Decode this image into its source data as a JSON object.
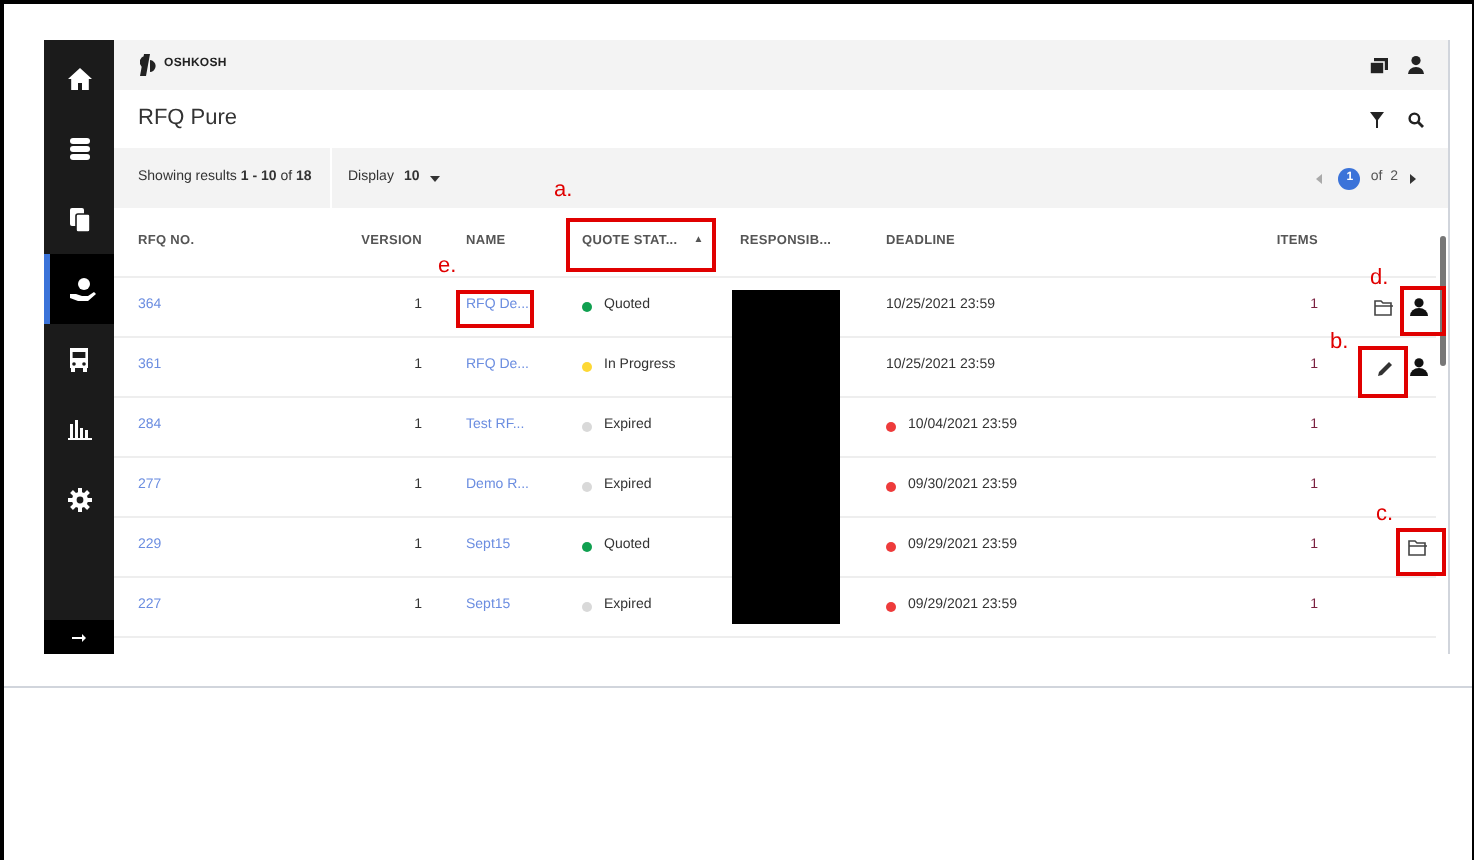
{
  "header": {
    "logo": "OSHKOSH"
  },
  "sidebar": {
    "items": [
      {
        "kind": "home",
        "selected": false
      },
      {
        "kind": "database",
        "selected": false
      },
      {
        "kind": "copies",
        "selected": false
      },
      {
        "kind": "hand",
        "selected": true
      },
      {
        "kind": "bus",
        "selected": false
      },
      {
        "kind": "chart",
        "selected": false
      },
      {
        "kind": "gear",
        "selected": false
      }
    ]
  },
  "page_title": "RFQ Pure",
  "toolbar": {
    "results": "Showing results **1 - 10** of **18**",
    "display_label": "Display",
    "display_value": "10",
    "current_page": "1",
    "of_pages": "of  2"
  },
  "table": {
    "columns": [
      {
        "label": "RFQ NO."
      },
      {
        "label": "VERSION"
      },
      {
        "label": "NAME"
      },
      {
        "label": "QUOTE STAT...",
        "sort": "▲"
      },
      {
        "label": "RESPONSIB..."
      },
      {
        "label": "DEADLINE"
      },
      {
        "label": "ITEMS"
      }
    ],
    "rows": [
      {
        "rfq": "364",
        "version": "1",
        "name": "RFQ De...",
        "status": "Quoted",
        "color": "#10a050",
        "deadline": "10/25/2021 23:59",
        "overdue": false,
        "items": "1",
        "actions": [
          {
            "kind": "folder"
          },
          {
            "kind": "person"
          }
        ]
      },
      {
        "rfq": "361",
        "version": "1",
        "name": "RFQ De...",
        "status": "In Progress",
        "color": "#fdd835",
        "deadline": "10/25/2021 23:59",
        "overdue": false,
        "items": "1",
        "actions": [
          {
            "kind": "pencil"
          },
          {
            "kind": "person"
          }
        ]
      },
      {
        "rfq": "284",
        "version": "1",
        "name": "Test RF...",
        "status": "Expired",
        "color": "#d9d9d9",
        "deadline": "10/04/2021 23:59",
        "overdue": true,
        "items": "1"
      },
      {
        "rfq": "277",
        "version": "1",
        "name": "Demo R...",
        "status": "Expired",
        "color": "#d9d9d9",
        "deadline": "09/30/2021 23:59",
        "overdue": true,
        "items": "1"
      },
      {
        "rfq": "229",
        "version": "1",
        "name": "Sept15",
        "status": "Quoted",
        "color": "#10a050",
        "deadline": "09/29/2021 23:59",
        "overdue": true,
        "items": "1",
        "actions": [
          {
            "kind": "folder"
          }
        ]
      },
      {
        "rfq": "227",
        "version": "1",
        "name": "Sept15",
        "status": "Expired",
        "color": "#d9d9d9",
        "deadline": "09/29/2021 23:59",
        "overdue": true,
        "items": "1"
      }
    ]
  },
  "annotations": [
    {
      "label": "a."
    },
    {
      "label": "e."
    },
    {
      "label": "d."
    },
    {
      "label": "b."
    },
    {
      "label": "c."
    }
  ]
}
